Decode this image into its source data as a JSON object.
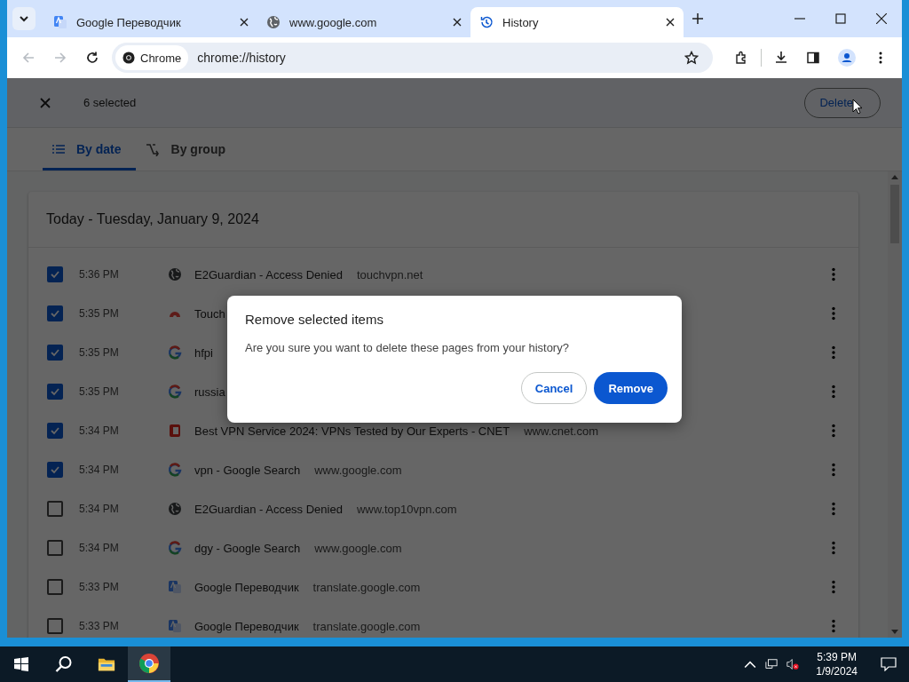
{
  "browser_tabs": [
    {
      "title": "Google Переводчик",
      "kind": "translate",
      "selected": false
    },
    {
      "title": "www.google.com",
      "kind": "globe",
      "selected": false
    },
    {
      "title": "History",
      "kind": "history",
      "selected": true
    }
  ],
  "address_bar": {
    "chip": "Chrome",
    "url": "chrome://history"
  },
  "selection_toolbar": {
    "count": "6 selected",
    "delete": "Delete"
  },
  "view_tabs": [
    {
      "label": "By date",
      "kind": "list",
      "selected": true
    },
    {
      "label": "By group",
      "kind": "group",
      "selected": false
    }
  ],
  "day_heading": "Today - Tuesday, January 9, 2024",
  "rows": [
    {
      "checked": true,
      "time": "5:36 PM",
      "kind": "globe",
      "title": "E2Guardian - Access Denied",
      "domain": "touchvpn.net"
    },
    {
      "checked": true,
      "time": "5:35 PM",
      "kind": "touchvpn",
      "title": "Touch"
    },
    {
      "checked": true,
      "time": "5:35 PM",
      "kind": "google",
      "title": "hfpi"
    },
    {
      "checked": true,
      "time": "5:35 PM",
      "kind": "google",
      "title": "russia"
    },
    {
      "checked": true,
      "time": "5:34 PM",
      "kind": "cnet",
      "title": "Best VPN Service 2024: VPNs Tested by Our Experts - CNET",
      "domain": "www.cnet.com"
    },
    {
      "checked": true,
      "time": "5:34 PM",
      "kind": "google",
      "title": "vpn - Google Search",
      "domain": "www.google.com"
    },
    {
      "checked": false,
      "time": "5:34 PM",
      "kind": "globe",
      "title": "E2Guardian - Access Denied",
      "domain": "www.top10vpn.com"
    },
    {
      "checked": false,
      "time": "5:34 PM",
      "kind": "google",
      "title": "dgy - Google Search",
      "domain": "www.google.com"
    },
    {
      "checked": false,
      "time": "5:33 PM",
      "kind": "translate",
      "title": "Google Переводчик",
      "domain": "translate.google.com"
    },
    {
      "checked": false,
      "time": "5:33 PM",
      "kind": "translate",
      "title": "Google Переводчик",
      "domain": "translate.google.com"
    }
  ],
  "dialog": {
    "title": "Remove selected items",
    "message": "Are you sure you want to delete these pages from your history?",
    "cancel": "Cancel",
    "confirm": "Remove"
  },
  "taskbar": {
    "time": "5:39 PM",
    "date": "1/9/2024"
  }
}
